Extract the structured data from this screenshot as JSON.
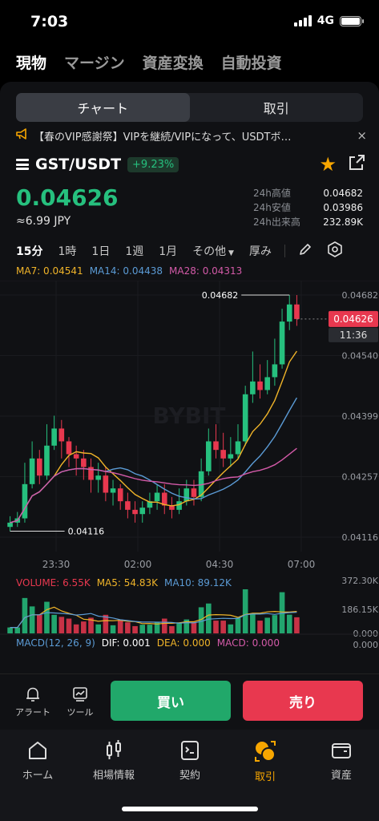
{
  "status": {
    "time": "7:03",
    "network": "4G"
  },
  "top_tabs": [
    {
      "label": "現物",
      "active": true
    },
    {
      "label": "マージン",
      "active": false
    },
    {
      "label": "資産変換",
      "active": false
    },
    {
      "label": "自動投資",
      "active": false
    }
  ],
  "view_toggle": {
    "chart": "チャート",
    "trade": "取引"
  },
  "banner": {
    "text": "【春のVIP感謝祭】VIPを継続/VIPになって、USDTボ…",
    "close": "×"
  },
  "pair": {
    "name": "GST/USDT",
    "change": "+9.23%"
  },
  "price": {
    "last": "0.04626",
    "jpy": "≈6.99 JPY"
  },
  "stats": {
    "high_label": "24h高値",
    "high": "0.04682",
    "low_label": "24h安値",
    "low": "0.03986",
    "vol_label": "24h出来高",
    "vol": "232.89K"
  },
  "intervals": {
    "items": [
      "15分",
      "1時",
      "1日",
      "1週",
      "1月"
    ],
    "active": "15分",
    "more": "その他",
    "depth": "厚み"
  },
  "ma": {
    "ma7": "MA7: 0.04541",
    "ma14": "MA14: 0.04438",
    "ma28": "MA28: 0.04313"
  },
  "volume": {
    "vol": "VOLUME: 6.55K",
    "ma5": "MA5: 54.83K",
    "ma10": "MA10: 89.12K"
  },
  "macd": {
    "label": "MACD(12, 26, 9)",
    "dif": "DIF: 0.001",
    "dea": "DEA: 0.000",
    "macd": "MACD: 0.000"
  },
  "actions": {
    "alert": "アラート",
    "tool": "ツール",
    "buy": "買い",
    "sell": "売り"
  },
  "nav": [
    {
      "label": "ホーム",
      "icon": "home-icon"
    },
    {
      "label": "相場情報",
      "icon": "candles-icon"
    },
    {
      "label": "契約",
      "icon": "contract-icon"
    },
    {
      "label": "取引",
      "icon": "trade-icon",
      "active": true
    },
    {
      "label": "資産",
      "icon": "wallet-icon"
    }
  ],
  "colors": {
    "up": "#26c07e",
    "down": "#e8384f",
    "ma7": "#f0b429",
    "ma14": "#5b9bd5",
    "ma28": "#d35aa8",
    "accent": "#f7a600"
  },
  "chart_data": {
    "type": "candlestick",
    "x_ticks": [
      "23:30",
      "02:00",
      "04:30",
      "07:00"
    ],
    "y_ticks": [
      "0.04682",
      "0.04540",
      "0.04399",
      "0.04257",
      "0.04116"
    ],
    "y_range": [
      0.04116,
      0.04682
    ],
    "high_marker": "0.04682",
    "low_marker": "0.04116",
    "last_price": "0.04626",
    "countdown": "11:36",
    "watermark": "BYBIT",
    "volume_ticks": [
      "372.30K",
      "186.15K",
      "0.000"
    ],
    "macd_ticks": [
      "0.000",
      "0.000",
      "0.000"
    ],
    "candles": [
      [
        0.0414,
        0.0415,
        0.04165,
        0.0413
      ],
      [
        0.0415,
        0.0416,
        0.04175,
        0.0414
      ],
      [
        0.0416,
        0.0424,
        0.0429,
        0.0415
      ],
      [
        0.0424,
        0.043,
        0.0434,
        0.0423
      ],
      [
        0.043,
        0.0426,
        0.0432,
        0.0424
      ],
      [
        0.0426,
        0.0433,
        0.0438,
        0.0425
      ],
      [
        0.0433,
        0.0437,
        0.044,
        0.0432
      ],
      [
        0.0437,
        0.0434,
        0.0439,
        0.043
      ],
      [
        0.0434,
        0.0431,
        0.0435,
        0.0428
      ],
      [
        0.0431,
        0.043,
        0.0433,
        0.0426
      ],
      [
        0.043,
        0.0428,
        0.0432,
        0.0425
      ],
      [
        0.0428,
        0.0425,
        0.043,
        0.0422
      ],
      [
        0.0425,
        0.0426,
        0.0429,
        0.0422
      ],
      [
        0.0426,
        0.0422,
        0.0428,
        0.042
      ],
      [
        0.0422,
        0.0423,
        0.0425,
        0.0419
      ],
      [
        0.0423,
        0.042,
        0.0424,
        0.0418
      ],
      [
        0.042,
        0.0418,
        0.0422,
        0.0416
      ],
      [
        0.0418,
        0.0417,
        0.042,
        0.0415
      ],
      [
        0.0417,
        0.04185,
        0.042,
        0.0415
      ],
      [
        0.04185,
        0.042,
        0.0422,
        0.0417
      ],
      [
        0.042,
        0.0422,
        0.0424,
        0.0418
      ],
      [
        0.0422,
        0.0419,
        0.0424,
        0.0417
      ],
      [
        0.0419,
        0.0418,
        0.0421,
        0.0416
      ],
      [
        0.0418,
        0.042,
        0.0423,
        0.0417
      ],
      [
        0.042,
        0.0423,
        0.0425,
        0.0419
      ],
      [
        0.0423,
        0.0421,
        0.0425,
        0.0419
      ],
      [
        0.0421,
        0.0427,
        0.043,
        0.042
      ],
      [
        0.0427,
        0.0434,
        0.0437,
        0.0426
      ],
      [
        0.0434,
        0.0432,
        0.0438,
        0.043
      ],
      [
        0.0432,
        0.043,
        0.0436,
        0.0428
      ],
      [
        0.043,
        0.0431,
        0.0435,
        0.0428
      ],
      [
        0.0431,
        0.0434,
        0.0438,
        0.043
      ],
      [
        0.0434,
        0.0445,
        0.0447,
        0.0433
      ],
      [
        0.0445,
        0.0448,
        0.0455,
        0.0443
      ],
      [
        0.0448,
        0.0446,
        0.0452,
        0.0444
      ],
      [
        0.0446,
        0.0449,
        0.0453,
        0.0445
      ],
      [
        0.0449,
        0.0452,
        0.0458,
        0.0447
      ],
      [
        0.0452,
        0.0462,
        0.0465,
        0.0451
      ],
      [
        0.0462,
        0.0466,
        0.04682,
        0.046
      ],
      [
        0.0466,
        0.04626,
        0.04682,
        0.0461
      ]
    ]
  }
}
